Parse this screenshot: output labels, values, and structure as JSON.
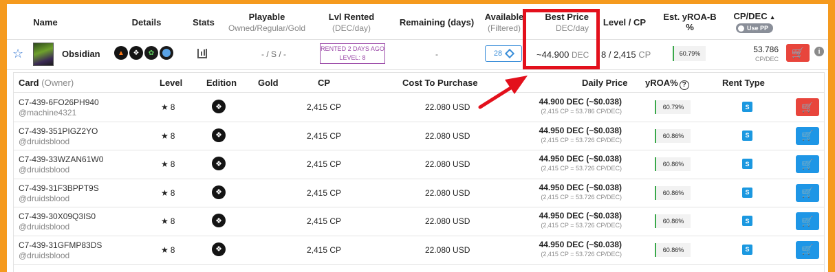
{
  "header": {
    "name": "Name",
    "details": "Details",
    "stats": "Stats",
    "playable": "Playable",
    "playable_sub": "Owned/Regular/Gold",
    "lvl_rented": "Lvl Rented",
    "lvl_rented_sub": "(DEC/day)",
    "remaining": "Remaining (days)",
    "available": "Available",
    "available_sub": "(Filtered)",
    "best_price": "Best Price",
    "best_price_sub": "DEC/day",
    "level_cp": "Level / CP",
    "yroa": "Est. yROA-B %",
    "cpdec": "CP/DEC",
    "toggle_label": "Use PP"
  },
  "card": {
    "name": "Obsidian",
    "playable": "- / S / -",
    "rented_line1": "RENTED 2 DAYS AGO",
    "rented_line2": "LEVEL: 8",
    "remaining": "-",
    "available_count": "28",
    "best_price": "~44.900",
    "best_price_unit": "DEC",
    "level_cp": "8 / 2,415",
    "level_cp_unit": "CP",
    "yroa": "60.79%",
    "cpdec_value": "53.786",
    "cpdec_unit": "CP/DEC",
    "info_glyph": "i"
  },
  "icons": {
    "star": "star-outline-icon",
    "cart": "cart-icon",
    "info": "info-icon",
    "edition": "edition-icon",
    "help": "help-icon",
    "layers": "layers-icon"
  },
  "colors": {
    "frame": "#f59a1e",
    "highlight": "#e3101c",
    "rent_red": "#e8453c",
    "rent_blue": "#1e96e6",
    "rented_purple": "#9b4aa8",
    "yroa_green": "#3aa84a"
  },
  "subtable": {
    "headers": {
      "card": "Card",
      "owner": "(Owner)",
      "level": "Level",
      "edition": "Edition",
      "gold": "Gold",
      "cp": "CP",
      "cost": "Cost To Purchase",
      "daily": "Daily Price",
      "yroa": "yROA%",
      "rent_type": "Rent Type",
      "help_glyph": "?"
    },
    "rows": [
      {
        "uid": "C7-439-6FO26PH940",
        "owner": "@machine4321",
        "level": "8",
        "cp": "2,415 CP",
        "cost": "22.080 USD",
        "price": "44.900 DEC (~$0.038)",
        "price_sub": "(2,415 CP = 53.786 CP/DEC)",
        "yroa": "60.79%",
        "rent_type": "S",
        "action": "red"
      },
      {
        "uid": "C7-439-351PIGZ2YO",
        "owner": "@druidsblood",
        "level": "8",
        "cp": "2,415 CP",
        "cost": "22.080 USD",
        "price": "44.950 DEC (~$0.038)",
        "price_sub": "(2,415 CP = 53.726 CP/DEC)",
        "yroa": "60.86%",
        "rent_type": "S",
        "action": "blue"
      },
      {
        "uid": "C7-439-33WZAN61W0",
        "owner": "@druidsblood",
        "level": "8",
        "cp": "2,415 CP",
        "cost": "22.080 USD",
        "price": "44.950 DEC (~$0.038)",
        "price_sub": "(2,415 CP = 53.726 CP/DEC)",
        "yroa": "60.86%",
        "rent_type": "S",
        "action": "blue"
      },
      {
        "uid": "C7-439-31F3BPPT9S",
        "owner": "@druidsblood",
        "level": "8",
        "cp": "2,415 CP",
        "cost": "22.080 USD",
        "price": "44.950 DEC (~$0.038)",
        "price_sub": "(2,415 CP = 53.726 CP/DEC)",
        "yroa": "60.86%",
        "rent_type": "S",
        "action": "blue"
      },
      {
        "uid": "C7-439-30X09Q3IS0",
        "owner": "@druidsblood",
        "level": "8",
        "cp": "2,415 CP",
        "cost": "22.080 USD",
        "price": "44.950 DEC (~$0.038)",
        "price_sub": "(2,415 CP = 53.726 CP/DEC)",
        "yroa": "60.86%",
        "rent_type": "S",
        "action": "blue"
      },
      {
        "uid": "C7-439-31GFMP83DS",
        "owner": "@druidsblood",
        "level": "8",
        "cp": "2,415 CP",
        "cost": "22.080 USD",
        "price": "44.950 DEC (~$0.038)",
        "price_sub": "(2,415 CP = 53.726 CP/DEC)",
        "yroa": "60.86%",
        "rent_type": "S",
        "action": "blue"
      }
    ]
  }
}
